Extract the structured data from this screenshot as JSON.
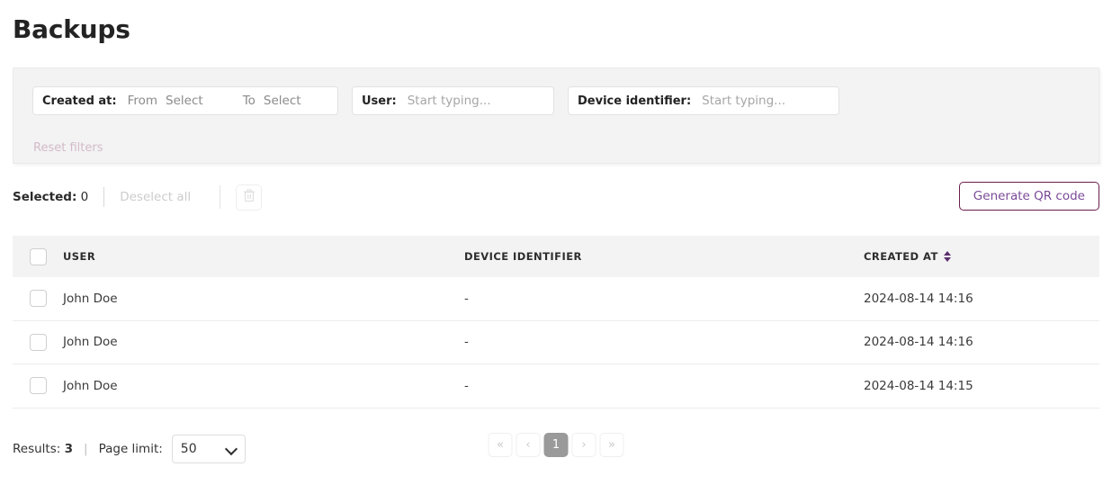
{
  "page": {
    "title": "Backups"
  },
  "filters": {
    "created_at": {
      "label": "Created at:",
      "from_label": "From",
      "from_value": "Select",
      "to_label": "To",
      "to_value": "Select"
    },
    "user": {
      "label": "User:",
      "placeholder": "Start typing...",
      "value": ""
    },
    "device_identifier": {
      "label": "Device identifier:",
      "placeholder": "Start typing...",
      "value": ""
    },
    "reset_label": "Reset filters"
  },
  "toolbar": {
    "selected_label": "Selected:",
    "selected_count": "0",
    "deselect_all_label": "Deselect all",
    "delete_icon": "trash-icon",
    "generate_qr_label": "Generate QR code",
    "accent_border": "#6a1d4f",
    "accent_text": "#7b4a98"
  },
  "table": {
    "columns": [
      {
        "key": "user",
        "label": "USER"
      },
      {
        "key": "device",
        "label": "DEVICE IDENTIFIER"
      },
      {
        "key": "created",
        "label": "CREATED AT",
        "sortable": true
      }
    ],
    "rows": [
      {
        "user": "John Doe",
        "device": "-",
        "created": "2024-08-14 14:16"
      },
      {
        "user": "John Doe",
        "device": "-",
        "created": "2024-08-14 14:16"
      },
      {
        "user": "John Doe",
        "device": "-",
        "created": "2024-08-14 14:15"
      }
    ]
  },
  "footer": {
    "results_label": "Results:",
    "results_count": "3",
    "separator": "|",
    "page_limit_label": "Page limit:",
    "page_limit_value": "50",
    "page_limit_options": [
      "50"
    ],
    "pagination": {
      "first": "«",
      "prev": "‹",
      "current": "1",
      "next": "›",
      "last": "»"
    }
  }
}
